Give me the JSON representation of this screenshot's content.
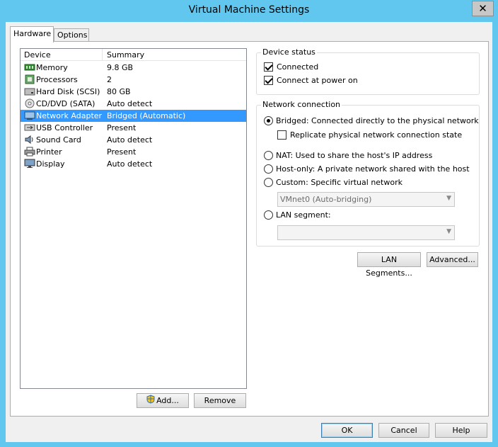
{
  "window": {
    "title": "Virtual Machine Settings",
    "close_glyph": "✕"
  },
  "tabs": [
    {
      "label": "Hardware",
      "active": true
    },
    {
      "label": "Options",
      "active": false
    }
  ],
  "device_list": {
    "columns": [
      "Device",
      "Summary"
    ],
    "rows": [
      {
        "name": "Memory",
        "summary": "9.8 GB",
        "icon": "memory-icon"
      },
      {
        "name": "Processors",
        "summary": "2",
        "icon": "processor-icon"
      },
      {
        "name": "Hard Disk (SCSI)",
        "summary": "80 GB",
        "icon": "hard-disk-icon"
      },
      {
        "name": "CD/DVD (SATA)",
        "summary": "Auto detect",
        "icon": "cd-dvd-icon"
      },
      {
        "name": "Network Adapter",
        "summary": "Bridged (Automatic)",
        "icon": "network-adapter-icon",
        "selected": true
      },
      {
        "name": "USB Controller",
        "summary": "Present",
        "icon": "usb-icon"
      },
      {
        "name": "Sound Card",
        "summary": "Auto detect",
        "icon": "sound-card-icon"
      },
      {
        "name": "Printer",
        "summary": "Present",
        "icon": "printer-icon"
      },
      {
        "name": "Display",
        "summary": "Auto detect",
        "icon": "display-icon"
      }
    ]
  },
  "list_buttons": {
    "add": "Add...",
    "remove": "Remove"
  },
  "device_status": {
    "title": "Device status",
    "connected": {
      "label": "Connected",
      "checked": true
    },
    "connect_at_power_on": {
      "label": "Connect at power on",
      "checked": true
    }
  },
  "network_connection": {
    "title": "Network connection",
    "bridged": "Bridged: Connected directly to the physical network",
    "replicate": "Replicate physical network connection state",
    "nat": "NAT: Used to share the host's IP address",
    "host_only": "Host-only: A private network shared with the host",
    "custom": "Custom: Specific virtual network",
    "custom_value": "VMnet0 (Auto-bridging)",
    "lan_segment": "LAN segment:",
    "lan_segment_value": "",
    "selected": "bridged"
  },
  "network_buttons": {
    "lan_segments": "LAN Segments...",
    "advanced": "Advanced..."
  },
  "dialog_buttons": {
    "ok": "OK",
    "cancel": "Cancel",
    "help": "Help"
  },
  "colors": {
    "title_bar": "#62c7ee",
    "selection": "#3399ff"
  }
}
